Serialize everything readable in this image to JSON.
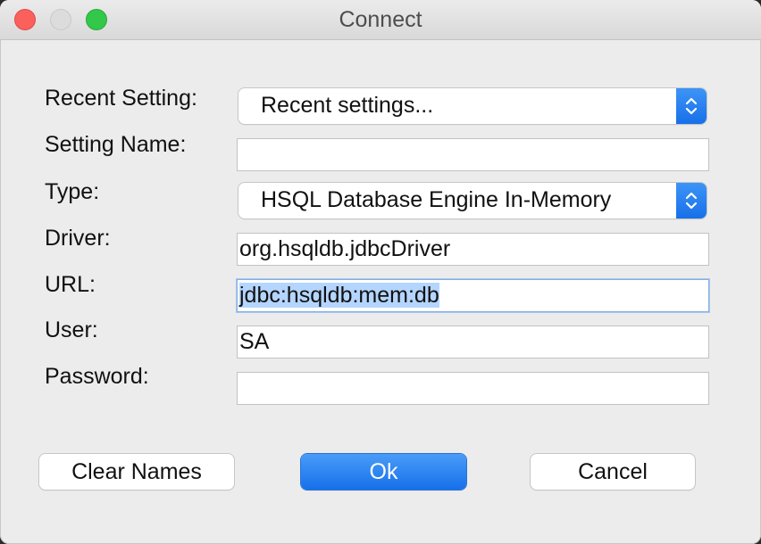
{
  "window": {
    "title": "Connect"
  },
  "form": {
    "recent_setting": {
      "label": "Recent Setting:",
      "value": "Recent settings..."
    },
    "setting_name": {
      "label": "Setting Name:",
      "value": ""
    },
    "type": {
      "label": "Type:",
      "value": "HSQL Database Engine In-Memory"
    },
    "driver": {
      "label": "Driver:",
      "value": "org.hsqldb.jdbcDriver"
    },
    "url": {
      "label": "URL:",
      "value": "jdbc:hsqldb:mem:db"
    },
    "user": {
      "label": "User:",
      "value": "SA"
    },
    "password": {
      "label": "Password:",
      "value": ""
    }
  },
  "buttons": {
    "clear_names": "Clear Names",
    "ok": "Ok",
    "cancel": "Cancel"
  },
  "colors": {
    "accent": "#1a73e8",
    "window_background": "#ececec",
    "selection": "#b4d5fe",
    "close": "#fc605c",
    "zoom": "#34c84a"
  },
  "icons": {
    "close": "close-icon",
    "minimize": "minimize-icon",
    "zoom": "zoom-icon",
    "stepper": "up-down-chevron-icon"
  }
}
